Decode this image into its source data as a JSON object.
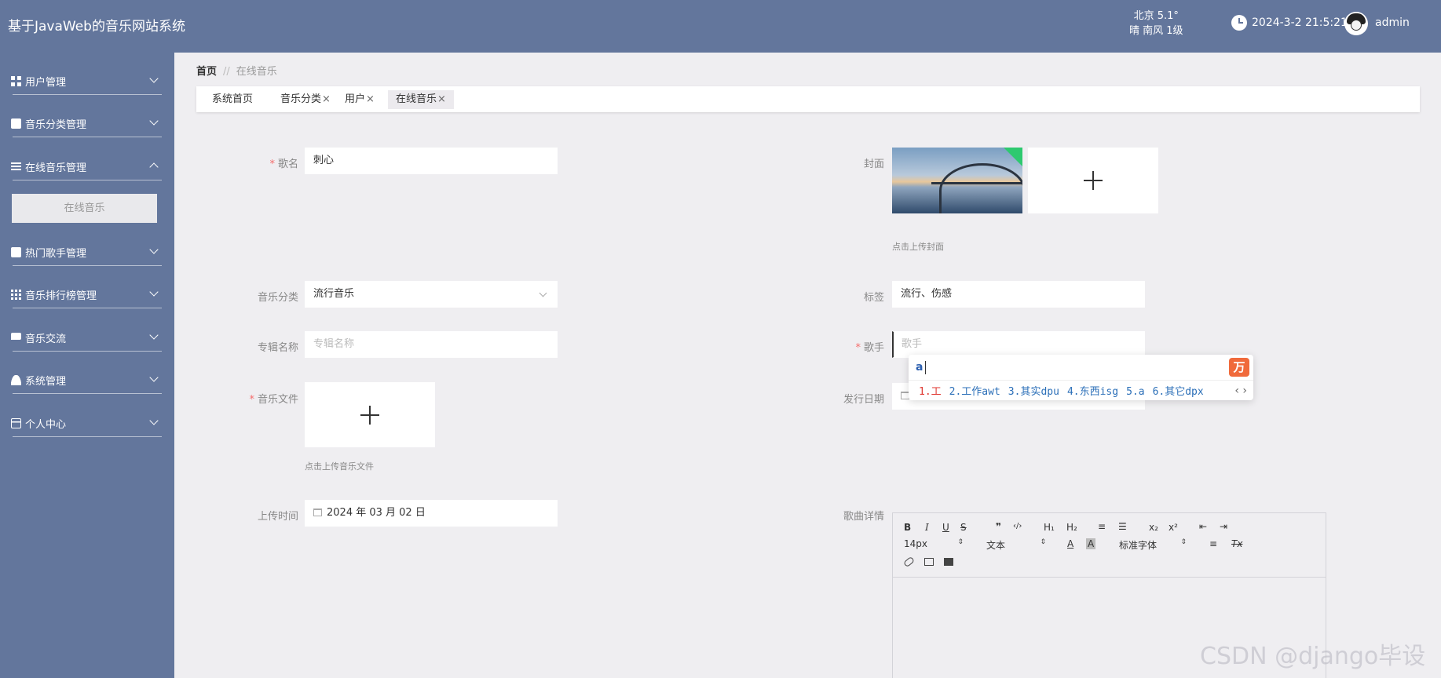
{
  "header": {
    "app_title": "基于JavaWeb的音乐网站系统",
    "weather_line1": "北京  5.1°",
    "weather_line2": "晴  南风  1级",
    "datetime": "2024-3-2 21:5:21",
    "username": "admin"
  },
  "sidebar": {
    "items": [
      {
        "label": "用户管理",
        "icon": "grid-icon"
      },
      {
        "label": "音乐分类管理",
        "icon": "clipboard-icon"
      },
      {
        "label": "在线音乐管理",
        "icon": "list-icon",
        "expanded": true
      },
      {
        "label": "热门歌手管理",
        "icon": "clipboard-check-icon"
      },
      {
        "label": "音乐排行榜管理",
        "icon": "table-icon"
      },
      {
        "label": "音乐交流",
        "icon": "chat-icon"
      },
      {
        "label": "系统管理",
        "icon": "user-icon"
      },
      {
        "label": "个人中心",
        "icon": "card-icon"
      }
    ],
    "submenu_active": "在线音乐"
  },
  "breadcrumb": {
    "home": "首页",
    "separator": "//",
    "current": "在线音乐"
  },
  "tabs": [
    {
      "label": "系统首页",
      "closable": false
    },
    {
      "label": "音乐分类",
      "closable": true
    },
    {
      "label": "用户",
      "closable": true
    },
    {
      "label": "在线音乐",
      "closable": true,
      "active": true
    }
  ],
  "tab_close_glyph": "×",
  "form": {
    "song_name": {
      "label": "歌名",
      "value": "刺心",
      "required": true
    },
    "cover": {
      "label": "封面",
      "tip": "点击上传封面"
    },
    "category": {
      "label": "音乐分类",
      "value": "流行音乐"
    },
    "tags": {
      "label": "标签",
      "value": "流行、伤感"
    },
    "album": {
      "label": "专辑名称",
      "placeholder": "专辑名称"
    },
    "singer": {
      "label": "歌手",
      "placeholder": "歌手",
      "required": true
    },
    "music_file": {
      "label": "音乐文件",
      "tip": "点击上传音乐文件",
      "required": true
    },
    "release_date": {
      "label": "发行日期"
    },
    "upload_time": {
      "label": "上传时间",
      "value": "2024 年 03 月 02 日"
    },
    "details": {
      "label": "歌曲详情"
    }
  },
  "required_mark": "*",
  "ime": {
    "input": "a",
    "logo": "万",
    "candidates": [
      "1.工",
      "2.工作awt",
      "3.其实dpu",
      "4.东西isg",
      "5.a",
      "6.其它dpx"
    ],
    "nav": "‹ ›"
  },
  "editor": {
    "bold": "B",
    "italic": "I",
    "underline": "U",
    "strike": "S",
    "quote": "❞",
    "code": "‹/›",
    "h1": "H₁",
    "h2": "H₂",
    "ordered_list": "≡",
    "bullet_list": "☰",
    "subscript": "x₂",
    "superscript": "x²",
    "outdent": "⇤",
    "indent": "⇥",
    "font_size": "14px",
    "text_type": "文本",
    "font_family": "标准字体",
    "color": "A",
    "background": "A",
    "align": "≡",
    "clear": "Tx",
    "select_arrow": "⇕"
  },
  "watermark": "CSDN @django毕设",
  "colors": {
    "primary": "#63769c",
    "background": "#efeef1",
    "required": "#f56c6c"
  }
}
